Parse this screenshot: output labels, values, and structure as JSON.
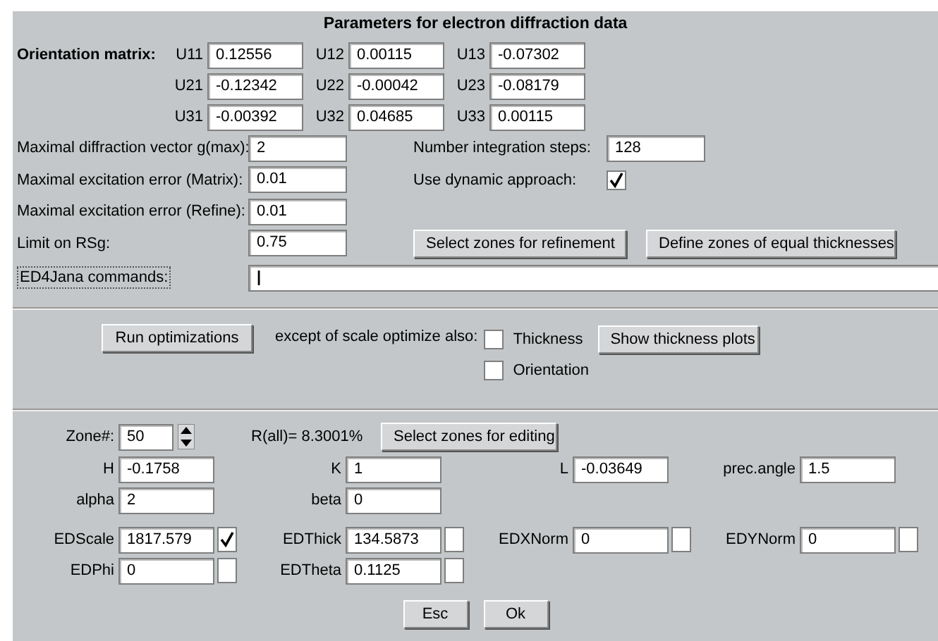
{
  "window": {
    "title": "Parameters for electron diffraction data"
  },
  "orientation_matrix": {
    "label": "Orientation matrix:",
    "rows": [
      [
        {
          "label": "U11",
          "value": "0.12556"
        },
        {
          "label": "U12",
          "value": "0.00115"
        },
        {
          "label": "U13",
          "value": "-0.07302"
        }
      ],
      [
        {
          "label": "U21",
          "value": "-0.12342"
        },
        {
          "label": "U22",
          "value": "-0.00042"
        },
        {
          "label": "U23",
          "value": "-0.08179"
        }
      ],
      [
        {
          "label": "U31",
          "value": "-0.00392"
        },
        {
          "label": "U32",
          "value": "0.04685"
        },
        {
          "label": "U33",
          "value": "0.00115"
        }
      ]
    ]
  },
  "parameters": [
    {
      "label": "Maximal diffraction vector g(max):",
      "value": "2",
      "right": {
        "kind": "field",
        "label": "Number integration steps:",
        "value": "128"
      }
    },
    {
      "label": "Maximal excitation error (Matrix):",
      "value": "0.01",
      "right": {
        "kind": "checkbox",
        "label": "Use dynamic approach:",
        "checked": true
      }
    },
    {
      "label": "Maximal excitation error (Refine):",
      "value": "0.01"
    },
    {
      "label": "Limit on RSg:",
      "value": "0.75",
      "buttons": [
        "Select zones for refinement",
        "Define zones of equal thicknesses"
      ]
    }
  ],
  "commands": {
    "label": "ED4Jana commands:",
    "value": "|"
  },
  "optimization": {
    "button": "Run optimizations",
    "text": "except of scale optimize also:",
    "options": [
      {
        "label": "Thickness",
        "checked": false
      },
      {
        "label": "Orientation",
        "checked": false
      }
    ],
    "plots_button": "Show thickness plots"
  },
  "zone": {
    "label": "Zone#:",
    "value": "50",
    "r_all": "R(all)=  8.3001%",
    "button": "Select zones for editing"
  },
  "field_rows": [
    [
      {
        "label": "H",
        "value": "-0.1758"
      },
      {
        "label": "K",
        "value": "1"
      },
      {
        "label": "L",
        "value": "-0.03649"
      },
      {
        "label": "prec.angle",
        "value": "1.5"
      }
    ],
    [
      {
        "label": "alpha",
        "value": "2"
      },
      {
        "label": "beta",
        "value": "0"
      }
    ],
    [
      {
        "label": "EDScale",
        "value": "1817.579",
        "checked": true
      },
      {
        "label": "EDThick",
        "value": "134.5873",
        "checked": false
      },
      {
        "label": "EDXNorm",
        "value": "0",
        "checked": false
      },
      {
        "label": "EDYNorm",
        "value": "0",
        "checked": false
      }
    ],
    [
      {
        "label": "EDPhi",
        "value": "0",
        "checked": false
      },
      {
        "label": "EDTheta",
        "value": "0.1125",
        "checked": false
      }
    ]
  ],
  "buttons": [
    "Esc",
    "Ok"
  ]
}
